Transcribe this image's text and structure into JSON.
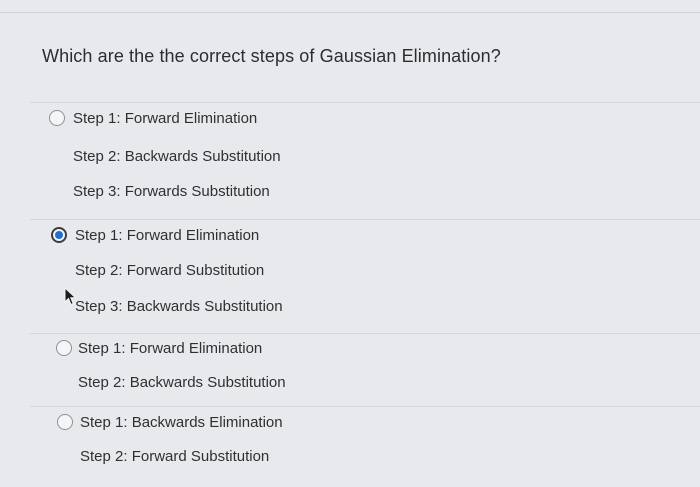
{
  "question": {
    "text": "Which are the the correct steps of Gaussian Elimination?"
  },
  "options": [
    {
      "selected": false,
      "lines": [
        "Step 1: Forward Elimination",
        "Step 2: Backwards Substitution",
        "Step 3: Forwards Substitution"
      ]
    },
    {
      "selected": true,
      "lines": [
        "Step 1: Forward Elimination",
        "Step 2: Forward Substitution",
        "Step 3: Backwards Substitution"
      ]
    },
    {
      "selected": false,
      "lines": [
        "Step 1: Forward Elimination",
        "Step 2: Backwards Substitution"
      ]
    },
    {
      "selected": false,
      "lines": [
        "Step 1: Backwards Elimination",
        "Step 2: Forward Substitution"
      ]
    }
  ],
  "colors": {
    "radio_selected": "#1f6fd1",
    "background": "#e8e9ec",
    "text": "#2f3032"
  },
  "icons": {
    "cursor": "mouse-pointer-icon"
  }
}
